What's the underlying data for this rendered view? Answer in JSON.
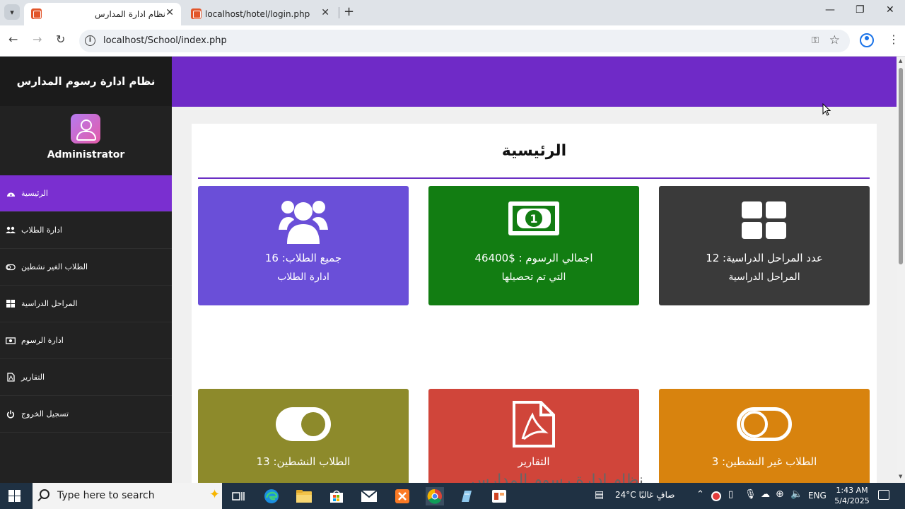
{
  "browser": {
    "tabs": [
      {
        "title": "نظام ادارة المدارس",
        "active": true
      },
      {
        "title": "localhost/hotel/login.php",
        "active": false
      }
    ],
    "url": "localhost/School/index.php"
  },
  "sidebar": {
    "app_title": "نظام ادارة رسوم المدارس",
    "user": "Administrator",
    "items": [
      {
        "label": "الرئيسية",
        "icon": "dashboard-icon",
        "active": true
      },
      {
        "label": "ادارة الطلاب",
        "icon": "users-icon",
        "active": false
      },
      {
        "label": "الطلاب الغير نشطين",
        "icon": "toggle-off-icon",
        "active": false
      },
      {
        "label": "المراحل الدراسية",
        "icon": "grid-icon",
        "active": false
      },
      {
        "label": "ادارة الرسوم",
        "icon": "money-icon",
        "active": false
      },
      {
        "label": "التقارير",
        "icon": "pdf-icon",
        "active": false
      },
      {
        "label": "تسجيل الخروج",
        "icon": "power-icon",
        "active": false
      }
    ]
  },
  "main": {
    "title": "الرئيسية",
    "cards": [
      {
        "line1": "جميع الطلاب: 16",
        "line2": "ادارة الطلاب",
        "icon": "users-icon",
        "color": "#6a4fd8"
      },
      {
        "line1": "اجمالي الرسوم : $46400",
        "line2": "التي تم تحصيلها",
        "icon": "money-bill-icon",
        "color": "#127d12"
      },
      {
        "line1": "عدد المراحل الدراسية: 12",
        "line2": "المراحل الدراسية",
        "icon": "grid-icon",
        "color": "#3a3a3a"
      },
      {
        "line1": "الطلاب النشطين: 13",
        "icon": "toggle-on-icon",
        "color": "#8d8a2b"
      },
      {
        "line1": "التقارير",
        "icon": "pdf-icon",
        "color": "#d0453a"
      },
      {
        "line1": "الطلاب غير النشطين: 3",
        "icon": "toggle-off-icon",
        "color": "#d8830e"
      }
    ],
    "lower_heading": "نظام ادارة رسوم المدارس"
  },
  "taskbar": {
    "search_placeholder": "Type here to search",
    "weather": "24°C  صافٍ غالبًا",
    "language": "ENG",
    "time": "1:43 AM",
    "date": "5/4/2025"
  },
  "colors": {
    "accent": "#6f2ac7",
    "sidebar_bg": "#222222",
    "active_item": "#7a2fd0"
  }
}
